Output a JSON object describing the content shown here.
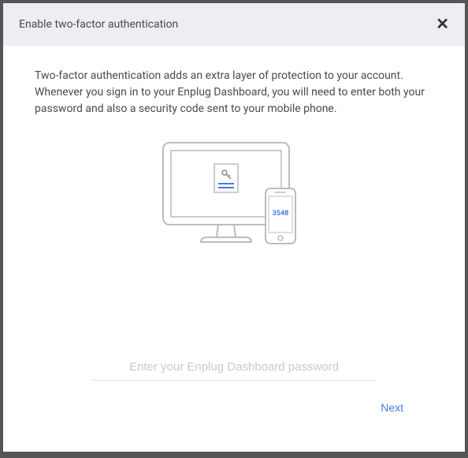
{
  "header": {
    "title": "Enable two-factor authentication"
  },
  "body": {
    "description": "Two-factor authentication adds an extra layer of protection to your account. Whenever you sign in to your Enplug Dashboard, you will need to enter both your password and also a security code sent to your mobile phone."
  },
  "illustration": {
    "phone_code": "3548"
  },
  "form": {
    "password_placeholder": "Enter your Enplug Dashboard password"
  },
  "footer": {
    "next_label": "Next"
  }
}
